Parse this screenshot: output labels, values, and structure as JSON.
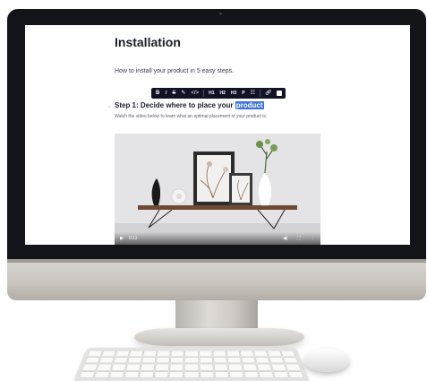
{
  "document": {
    "title": "Installation",
    "subtitle": "How to install your product in 5 easy steps.",
    "step_heading_prefix": "Step 1: Decide where to place your ",
    "step_heading_selected": "product",
    "step_description": "Watch the video below to learn what an optimal placement of your product is:"
  },
  "toolbar": {
    "bold": "B",
    "italic": "I",
    "strike": "S",
    "highlight_icon": "pencil-icon",
    "code_icon": "code-icon",
    "h1": "H1",
    "h2": "H2",
    "h3": "H3",
    "paragraph": "P",
    "list_icon": "list-icon",
    "link_icon": "link-icon",
    "image_icon": "image-icon"
  },
  "gutter": {
    "icon": "drag-handle-icon",
    "glyph": "⇔"
  },
  "video": {
    "current_time": "0:11",
    "scene": "shelf with vases and framed botanical prints",
    "controls": [
      "play-icon",
      "volume-icon",
      "fullscreen-icon",
      "more-icon"
    ]
  },
  "colors": {
    "toolbar_bg": "#111325",
    "selection": "#3d73d6",
    "bezel": "#131419"
  }
}
